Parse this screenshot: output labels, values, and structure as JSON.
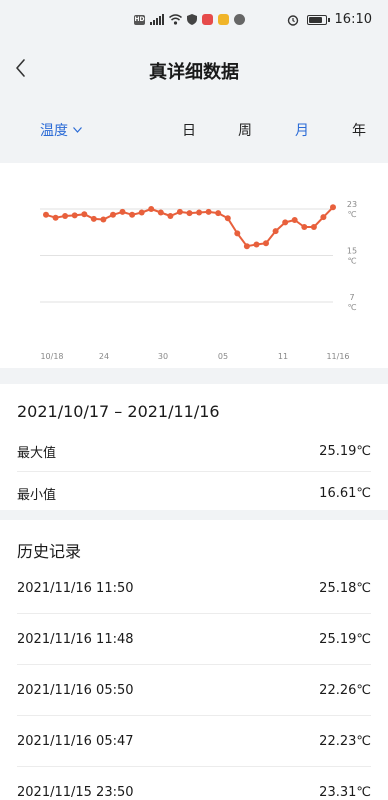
{
  "status_bar": {
    "hd_label": "HD",
    "time": "16:10"
  },
  "header": {
    "title": "真详细数据"
  },
  "filter": {
    "metric": "温度",
    "tabs": [
      {
        "label": "日",
        "active": false
      },
      {
        "label": "周",
        "active": false
      },
      {
        "label": "月",
        "active": true
      },
      {
        "label": "年",
        "active": false
      }
    ]
  },
  "chart_data": {
    "type": "line",
    "x_ticks": [
      "10/18",
      "24",
      "30",
      "05",
      "11",
      "11/16"
    ],
    "y_ticks": [
      {
        "value": 23,
        "unit": "℃"
      },
      {
        "value": 15,
        "unit": "℃"
      },
      {
        "value": 7,
        "unit": "℃"
      }
    ],
    "ylim": [
      7,
      23
    ],
    "series": [
      {
        "color": "#e8603c",
        "values": [
          22.0,
          21.5,
          21.8,
          21.9,
          22.1,
          21.3,
          21.2,
          22.0,
          22.5,
          22.0,
          22.4,
          23.0,
          22.4,
          21.8,
          22.5,
          22.3,
          22.4,
          22.5,
          22.3,
          21.4,
          18.8,
          16.6,
          16.9,
          17.1,
          19.2,
          20.7,
          21.1,
          19.9,
          19.9,
          21.6,
          23.3
        ]
      }
    ],
    "grid": true
  },
  "range": {
    "text": "2021/10/17 – 2021/11/16",
    "stats": [
      {
        "label": "最大值",
        "value": "25.19℃"
      },
      {
        "label": "最小值",
        "value": "16.61℃"
      }
    ]
  },
  "history": {
    "title": "历史记录",
    "rows": [
      {
        "time": "2021/11/16 11:50",
        "value": "25.18℃"
      },
      {
        "time": "2021/11/16 11:48",
        "value": "25.19℃"
      },
      {
        "time": "2021/11/16 05:50",
        "value": "22.26℃"
      },
      {
        "time": "2021/11/16 05:47",
        "value": "22.23℃"
      },
      {
        "time": "2021/11/15 23:50",
        "value": "23.31℃"
      }
    ]
  }
}
